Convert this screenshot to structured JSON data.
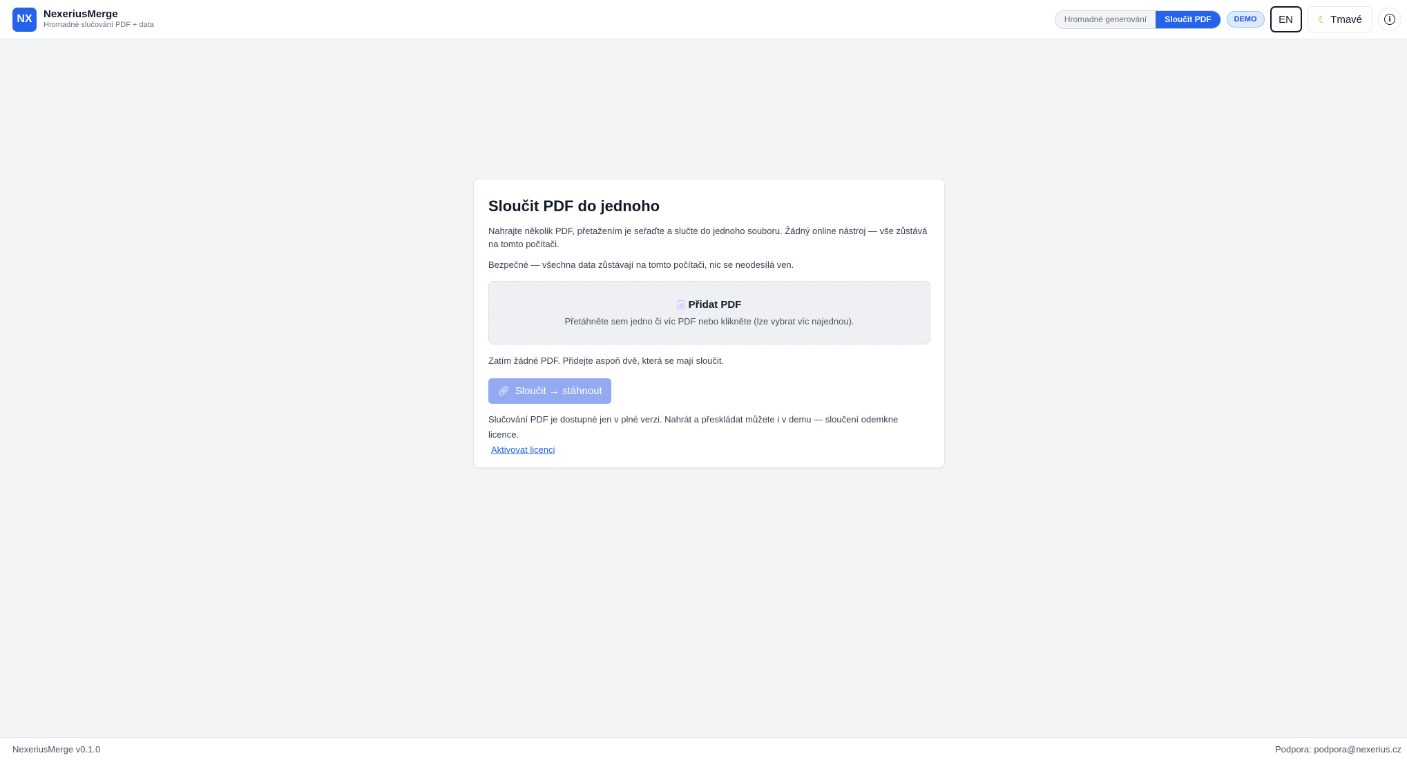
{
  "header": {
    "logo_text": "NX",
    "app_name": "NexeriusMerge",
    "app_subtitle": "Hromadné slučování PDF + data",
    "modes": [
      "Hromadné generování",
      "Sloučit PDF"
    ],
    "active_mode": "Sloučit PDF",
    "demo_badge": "DEMO",
    "lang_label": "EN",
    "theme_label": "Tmavé",
    "theme_icon": "moon-icon",
    "info_icon": "info-icon",
    "accent_color": "#2563eb"
  },
  "card": {
    "title": "Sloučit PDF do jednoho",
    "description": "Nahrajte několik PDF, přetažením je seřaďte a slučte do jednoho souboru. Žádný online nástroj — vše zůstává na tomto počítači.",
    "secure_note": "Bezpečné — všechna data zůstávají na tomto počítači, nic se neodesílá ven.",
    "dropzone": {
      "icon": "pdf-file-icon",
      "title": "Přidat PDF",
      "hint": "Přetáhněte sem jedno či víc PDF nebo klikněte (lze vybrat víc najednou)."
    },
    "empty_note": "Zatím žádné PDF. Přidejte aspoň dvě, která se mají sloučit.",
    "merge_button": {
      "icon": "link-icon",
      "label": "Sloučit → stáhnout"
    },
    "license_note": "Slučování PDF je dostupné jen v plné verzi. Nahrát a přeskládat můžete i v demu — sloučení odemkne licence.",
    "license_link": "Aktivovat licenci"
  },
  "footer": {
    "version": "NexeriusMerge v0.1.0",
    "support": "Podpora: podpora@nexerius.cz"
  }
}
